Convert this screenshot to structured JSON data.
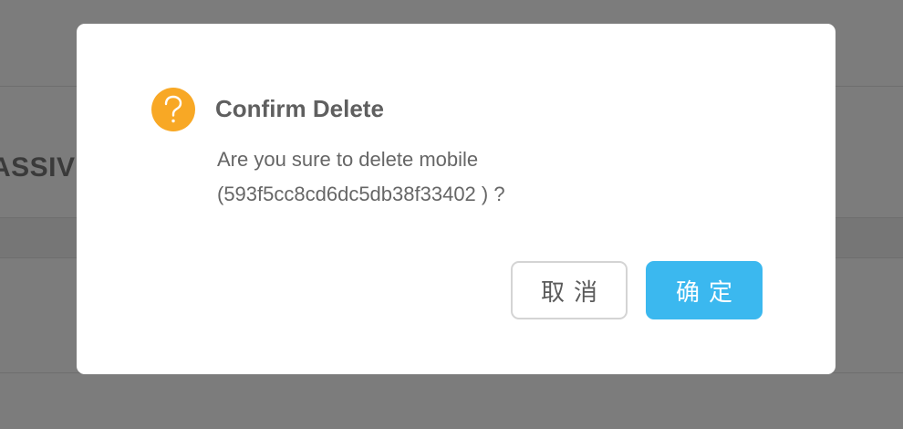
{
  "background": {
    "partial_heading": "ASSIV"
  },
  "dialog": {
    "icon": "question-circle-icon",
    "icon_color": "#f8a825",
    "title": "Confirm Delete",
    "message_line1": "Are you sure to delete mobile",
    "message_line2": "(593f5cc8cd6dc5db38f33402 ) ?",
    "cancel_label": "取消",
    "confirm_label": "确定",
    "confirm_color": "#3bb8ef"
  }
}
